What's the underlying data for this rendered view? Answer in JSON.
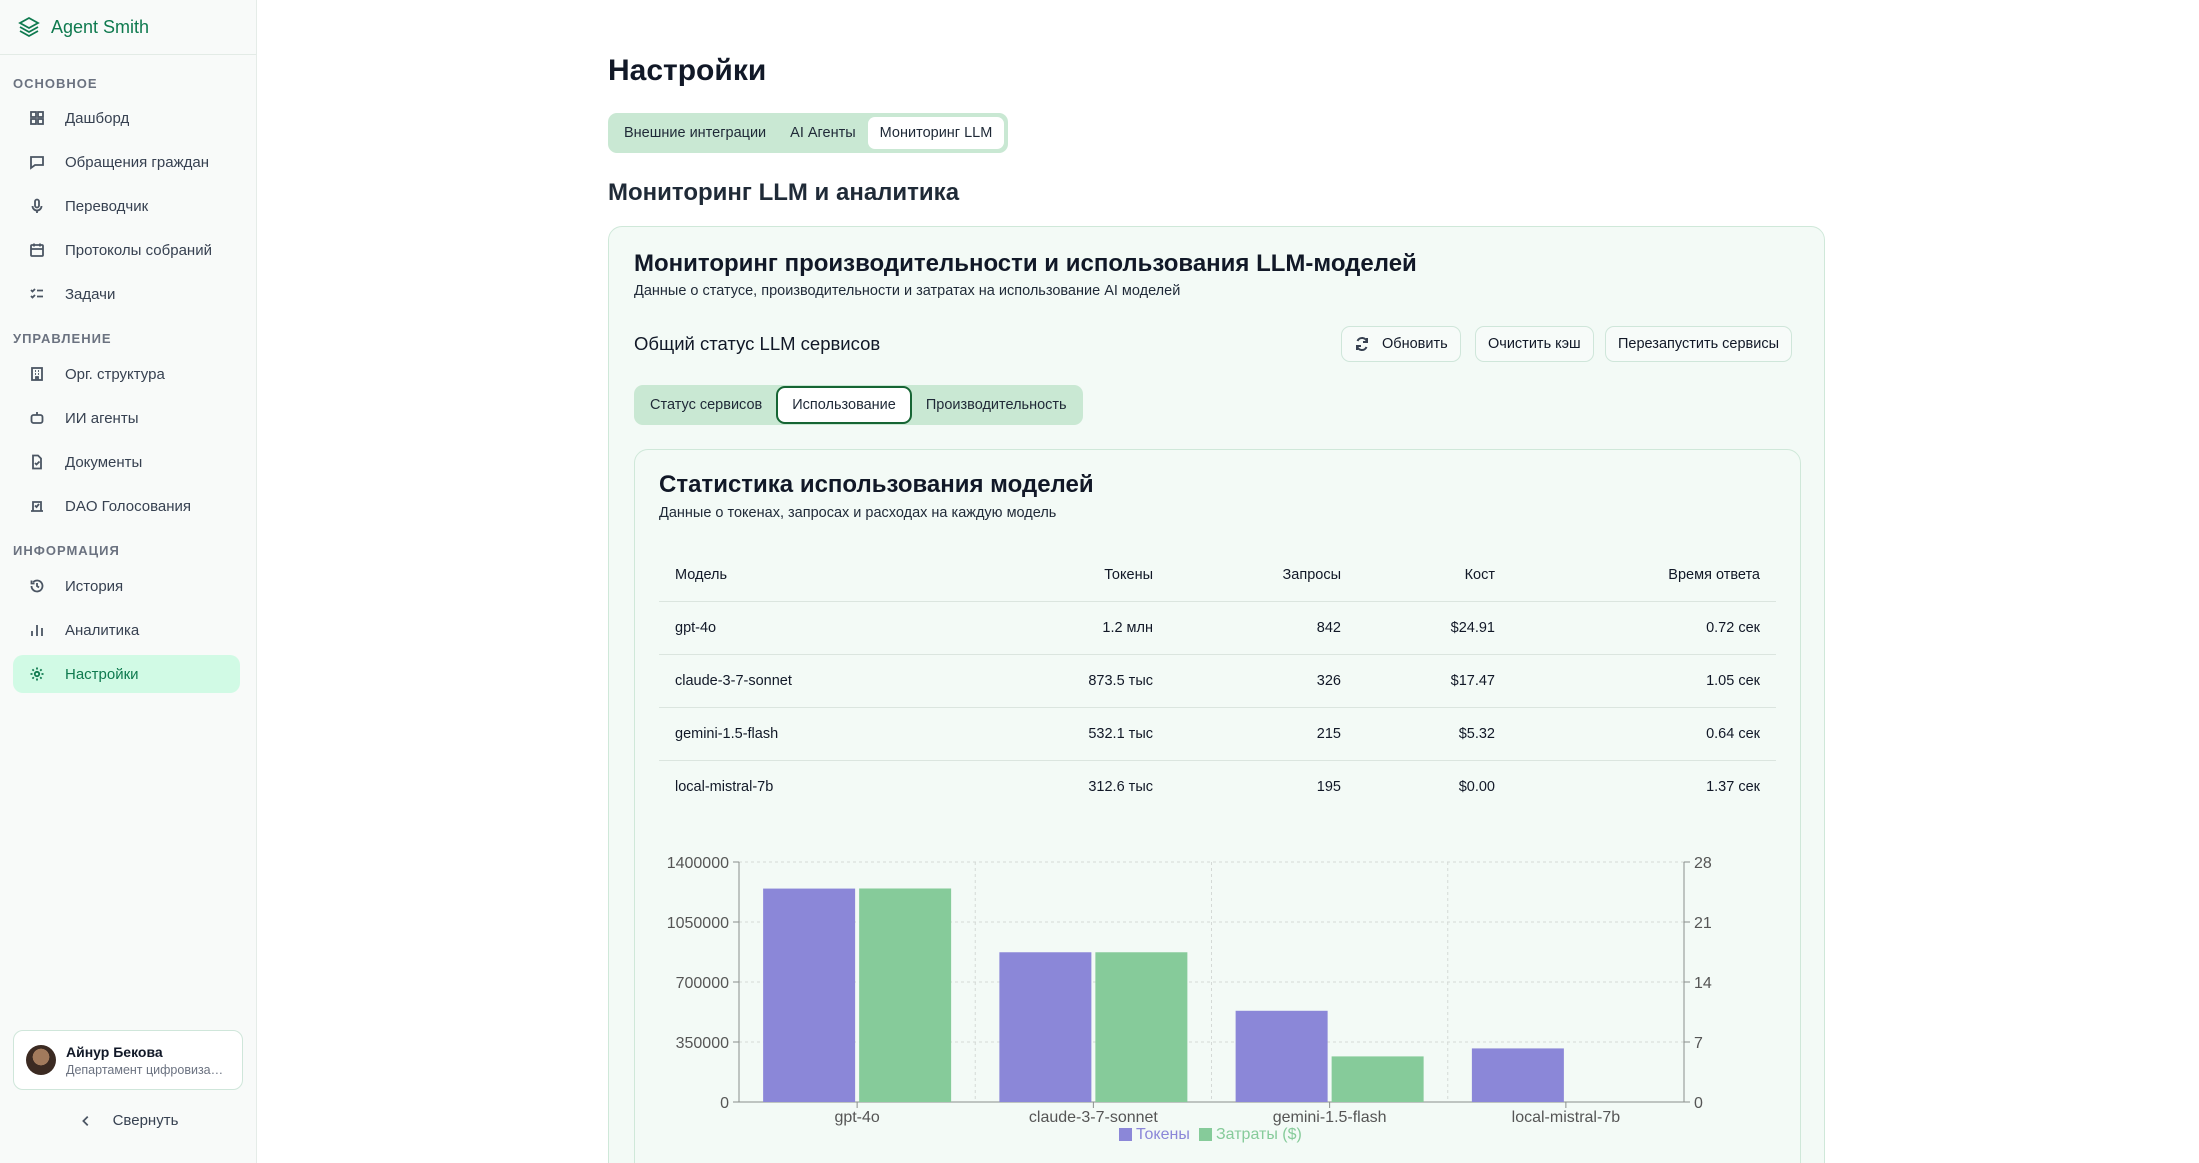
{
  "app": {
    "name": "Agent Smith"
  },
  "sidebar": {
    "sections": [
      {
        "title": "ОСНОВНОЕ",
        "items": [
          "Дашборд",
          "Обращения граждан",
          "Переводчик",
          "Протоколы собраний",
          "Задачи"
        ]
      },
      {
        "title": "УПРАВЛЕНИЕ",
        "items": [
          "Орг. структура",
          "ИИ агенты",
          "Документы",
          "DAO Голосования"
        ]
      },
      {
        "title": "ИНФОРМАЦИЯ",
        "items": [
          "История",
          "Аналитика",
          "Настройки"
        ]
      }
    ],
    "active_item": "Настройки",
    "user": {
      "name": "Айнур Бекова",
      "dept": "Департамент цифровизации"
    },
    "collapse_label": "Свернуть"
  },
  "page": {
    "title": "Настройки",
    "tabs": [
      "Внешние интеграции",
      "AI Агенты",
      "Мониторинг LLM"
    ],
    "active_tab": "Мониторинг LLM",
    "section_title": "Мониторинг LLM и аналитика"
  },
  "card": {
    "title": "Мониторинг производительности и использования LLM-моделей",
    "description": "Данные о статусе, производительности и затратах на использование AI моделей",
    "status_title": "Общий статус LLM сервисов",
    "buttons": {
      "refresh": "Обновить",
      "clear_cache": "Очистить кэш",
      "restart": "Перезапустить сервисы"
    },
    "tabs": [
      "Статус сервисов",
      "Использование",
      "Производительность"
    ],
    "active_tab": "Использование"
  },
  "usage": {
    "title": "Статистика использования моделей",
    "description": "Данные о токенах, запросах и расходах на каждую модель",
    "columns": [
      "Модель",
      "Токены",
      "Запросы",
      "Кост",
      "Время ответа"
    ],
    "rows": [
      [
        "gpt-4o",
        "1.2 млн",
        "842",
        "$24.91",
        "0.72 сек"
      ],
      [
        "claude-3-7-sonnet",
        "873.5 тыс",
        "326",
        "$17.47",
        "1.05 сек"
      ],
      [
        "gemini-1.5-flash",
        "532.1 тыс",
        "215",
        "$5.32",
        "0.64 сек"
      ],
      [
        "local-mistral-7b",
        "312.6 тыс",
        "195",
        "$0.00",
        "1.37 сек"
      ]
    ]
  },
  "chart_data": {
    "type": "bar",
    "categories": [
      "gpt-4o",
      "claude-3-7-sonnet",
      "gemini-1.5-flash",
      "local-mistral-7b"
    ],
    "series": [
      {
        "name": "Токены",
        "axis": "left",
        "color": "#8b87d8",
        "values": [
          1245000,
          873500,
          532100,
          312600
        ]
      },
      {
        "name": "Затраты ($)",
        "axis": "right",
        "color": "#86cb9a",
        "values": [
          24.91,
          17.47,
          5.32,
          0.0
        ]
      }
    ],
    "y_left": {
      "ticks": [
        0,
        350000,
        700000,
        1050000,
        1400000
      ],
      "ylim": [
        0,
        1400000
      ]
    },
    "y_right": {
      "ticks": [
        0,
        7,
        14,
        21,
        28
      ],
      "ylim": [
        0,
        28
      ]
    },
    "grid": true,
    "legend": "bottom"
  }
}
